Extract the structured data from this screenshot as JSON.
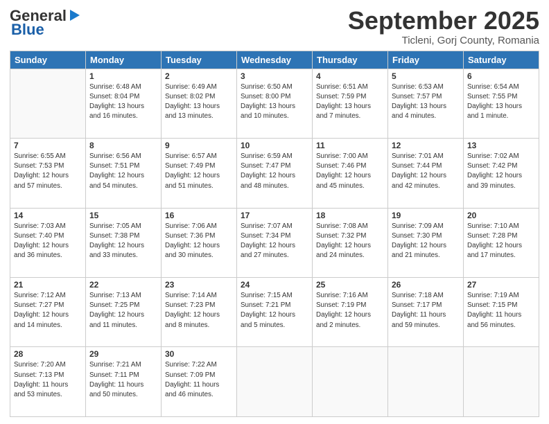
{
  "logo": {
    "general": "General",
    "blue": "Blue"
  },
  "title": "September 2025",
  "location": "Ticleni, Gorj County, Romania",
  "days_header": [
    "Sunday",
    "Monday",
    "Tuesday",
    "Wednesday",
    "Thursday",
    "Friday",
    "Saturday"
  ],
  "weeks": [
    [
      {
        "num": "",
        "info": ""
      },
      {
        "num": "1",
        "info": "Sunrise: 6:48 AM\nSunset: 8:04 PM\nDaylight: 13 hours\nand 16 minutes."
      },
      {
        "num": "2",
        "info": "Sunrise: 6:49 AM\nSunset: 8:02 PM\nDaylight: 13 hours\nand 13 minutes."
      },
      {
        "num": "3",
        "info": "Sunrise: 6:50 AM\nSunset: 8:00 PM\nDaylight: 13 hours\nand 10 minutes."
      },
      {
        "num": "4",
        "info": "Sunrise: 6:51 AM\nSunset: 7:59 PM\nDaylight: 13 hours\nand 7 minutes."
      },
      {
        "num": "5",
        "info": "Sunrise: 6:53 AM\nSunset: 7:57 PM\nDaylight: 13 hours\nand 4 minutes."
      },
      {
        "num": "6",
        "info": "Sunrise: 6:54 AM\nSunset: 7:55 PM\nDaylight: 13 hours\nand 1 minute."
      }
    ],
    [
      {
        "num": "7",
        "info": "Sunrise: 6:55 AM\nSunset: 7:53 PM\nDaylight: 12 hours\nand 57 minutes."
      },
      {
        "num": "8",
        "info": "Sunrise: 6:56 AM\nSunset: 7:51 PM\nDaylight: 12 hours\nand 54 minutes."
      },
      {
        "num": "9",
        "info": "Sunrise: 6:57 AM\nSunset: 7:49 PM\nDaylight: 12 hours\nand 51 minutes."
      },
      {
        "num": "10",
        "info": "Sunrise: 6:59 AM\nSunset: 7:47 PM\nDaylight: 12 hours\nand 48 minutes."
      },
      {
        "num": "11",
        "info": "Sunrise: 7:00 AM\nSunset: 7:46 PM\nDaylight: 12 hours\nand 45 minutes."
      },
      {
        "num": "12",
        "info": "Sunrise: 7:01 AM\nSunset: 7:44 PM\nDaylight: 12 hours\nand 42 minutes."
      },
      {
        "num": "13",
        "info": "Sunrise: 7:02 AM\nSunset: 7:42 PM\nDaylight: 12 hours\nand 39 minutes."
      }
    ],
    [
      {
        "num": "14",
        "info": "Sunrise: 7:03 AM\nSunset: 7:40 PM\nDaylight: 12 hours\nand 36 minutes."
      },
      {
        "num": "15",
        "info": "Sunrise: 7:05 AM\nSunset: 7:38 PM\nDaylight: 12 hours\nand 33 minutes."
      },
      {
        "num": "16",
        "info": "Sunrise: 7:06 AM\nSunset: 7:36 PM\nDaylight: 12 hours\nand 30 minutes."
      },
      {
        "num": "17",
        "info": "Sunrise: 7:07 AM\nSunset: 7:34 PM\nDaylight: 12 hours\nand 27 minutes."
      },
      {
        "num": "18",
        "info": "Sunrise: 7:08 AM\nSunset: 7:32 PM\nDaylight: 12 hours\nand 24 minutes."
      },
      {
        "num": "19",
        "info": "Sunrise: 7:09 AM\nSunset: 7:30 PM\nDaylight: 12 hours\nand 21 minutes."
      },
      {
        "num": "20",
        "info": "Sunrise: 7:10 AM\nSunset: 7:28 PM\nDaylight: 12 hours\nand 17 minutes."
      }
    ],
    [
      {
        "num": "21",
        "info": "Sunrise: 7:12 AM\nSunset: 7:27 PM\nDaylight: 12 hours\nand 14 minutes."
      },
      {
        "num": "22",
        "info": "Sunrise: 7:13 AM\nSunset: 7:25 PM\nDaylight: 12 hours\nand 11 minutes."
      },
      {
        "num": "23",
        "info": "Sunrise: 7:14 AM\nSunset: 7:23 PM\nDaylight: 12 hours\nand 8 minutes."
      },
      {
        "num": "24",
        "info": "Sunrise: 7:15 AM\nSunset: 7:21 PM\nDaylight: 12 hours\nand 5 minutes."
      },
      {
        "num": "25",
        "info": "Sunrise: 7:16 AM\nSunset: 7:19 PM\nDaylight: 12 hours\nand 2 minutes."
      },
      {
        "num": "26",
        "info": "Sunrise: 7:18 AM\nSunset: 7:17 PM\nDaylight: 11 hours\nand 59 minutes."
      },
      {
        "num": "27",
        "info": "Sunrise: 7:19 AM\nSunset: 7:15 PM\nDaylight: 11 hours\nand 56 minutes."
      }
    ],
    [
      {
        "num": "28",
        "info": "Sunrise: 7:20 AM\nSunset: 7:13 PM\nDaylight: 11 hours\nand 53 minutes."
      },
      {
        "num": "29",
        "info": "Sunrise: 7:21 AM\nSunset: 7:11 PM\nDaylight: 11 hours\nand 50 minutes."
      },
      {
        "num": "30",
        "info": "Sunrise: 7:22 AM\nSunset: 7:09 PM\nDaylight: 11 hours\nand 46 minutes."
      },
      {
        "num": "",
        "info": ""
      },
      {
        "num": "",
        "info": ""
      },
      {
        "num": "",
        "info": ""
      },
      {
        "num": "",
        "info": ""
      }
    ]
  ]
}
